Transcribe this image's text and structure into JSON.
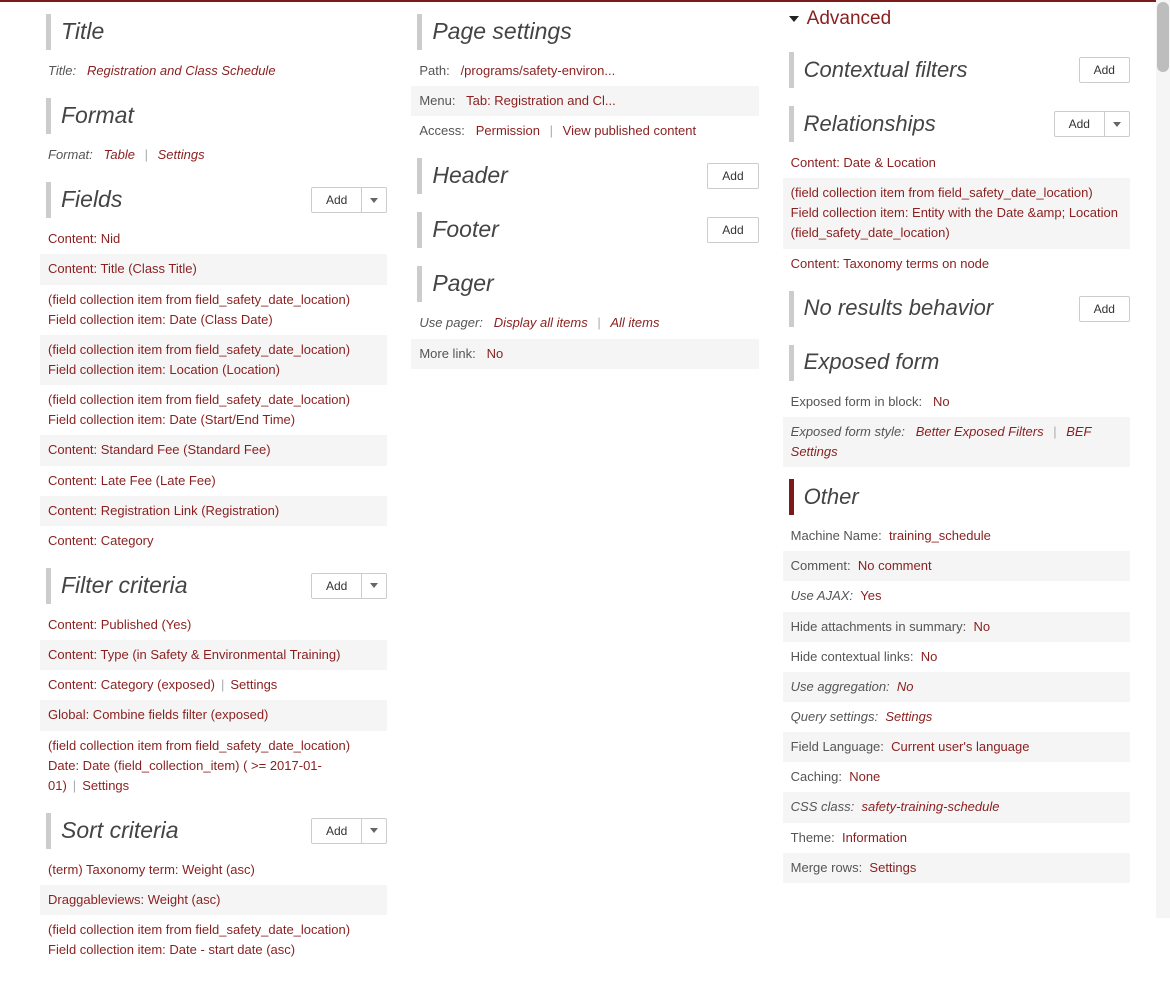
{
  "add_label": "Add",
  "col1": {
    "title_section": {
      "heading": "Title",
      "label": "Title:",
      "value": "Registration and Class Schedule"
    },
    "format_section": {
      "heading": "Format",
      "label": "Format:",
      "value": "Table",
      "settings": "Settings"
    },
    "fields_section": {
      "heading": "Fields",
      "items": [
        "Content: Nid",
        "Content: Title (Class Title)",
        "(field collection item from field_safety_date_location) Field collection item: Date (Class Date)",
        "(field collection item from field_safety_date_location) Field collection item: Location (Location)",
        "(field collection item from field_safety_date_location) Field collection item: Date (Start/End Time)",
        "Content: Standard Fee (Standard Fee)",
        "Content: Late Fee (Late Fee)",
        "Content: Registration Link (Registration)",
        "Content: Category"
      ]
    },
    "filters_section": {
      "heading": "Filter criteria",
      "items": [
        {
          "text": "Content: Published (Yes)"
        },
        {
          "text": "Content: Type (in Safety & Environmental Training)"
        },
        {
          "text": "Content: Category (exposed)",
          "settings": "Settings"
        },
        {
          "text": "Global: Combine fields filter (exposed)"
        },
        {
          "text": "(field collection item from field_safety_date_location) Date: Date (field_collection_item) ( >= 2017-01-01)",
          "settings": "Settings"
        }
      ]
    },
    "sort_section": {
      "heading": "Sort criteria",
      "items": [
        "(term) Taxonomy term: Weight (asc)",
        "Draggableviews: Weight (asc)",
        "(field collection item from field_safety_date_location) Field collection item: Date - start date (asc)"
      ]
    }
  },
  "col2": {
    "page_settings": {
      "heading": "Page settings",
      "path_label": "Path:",
      "path_value": "/programs/safety-environ...",
      "menu_label": "Menu:",
      "menu_value": "Tab: Registration and Cl...",
      "access_label": "Access:",
      "access_value": "Permission",
      "access_extra": "View published content"
    },
    "header": {
      "heading": "Header"
    },
    "footer": {
      "heading": "Footer"
    },
    "pager": {
      "heading": "Pager",
      "use_pager_label": "Use pager:",
      "use_pager_value": "Display all items",
      "use_pager_extra": "All items",
      "more_label": "More link:",
      "more_value": "No"
    }
  },
  "col3": {
    "advanced": "Advanced",
    "contextual": {
      "heading": "Contextual filters"
    },
    "relationships": {
      "heading": "Relationships",
      "items": [
        "Content: Date & Location",
        "(field collection item from field_safety_date_location) Field collection item: Entity with the Date &amp; Location (field_safety_date_location)",
        "Content: Taxonomy terms on node"
      ]
    },
    "no_results": {
      "heading": "No results behavior"
    },
    "exposed": {
      "heading": "Exposed form",
      "block_label": "Exposed form in block:",
      "block_value": "No",
      "style_label": "Exposed form style:",
      "style_value": "Better Exposed Filters",
      "style_extra": "BEF Settings"
    },
    "other": {
      "heading": "Other",
      "rows": [
        {
          "label": "Machine Name:",
          "value": "training_schedule"
        },
        {
          "label": "Comment:",
          "value": "No comment"
        },
        {
          "label": "Use AJAX:",
          "value": "Yes",
          "label_italic": true
        },
        {
          "label": "Hide attachments in summary:",
          "value": "No"
        },
        {
          "label": "Hide contextual links:",
          "value": "No"
        },
        {
          "label": "Use aggregation:",
          "value": "No",
          "label_italic": true,
          "value_italic": true
        },
        {
          "label": "Query settings:",
          "value": "Settings",
          "label_italic": true,
          "value_italic": true
        },
        {
          "label": "Field Language:",
          "value": "Current user's language"
        },
        {
          "label": "Caching:",
          "value": "None"
        },
        {
          "label": "CSS class:",
          "value": "safety-training-schedule",
          "label_italic": true,
          "value_italic": true
        },
        {
          "label": "Theme:",
          "value": "Information"
        },
        {
          "label": "Merge rows:",
          "value": "Settings"
        }
      ]
    }
  }
}
